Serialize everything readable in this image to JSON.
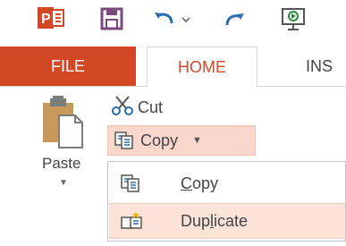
{
  "quick_access": {
    "logo_icon": "powerpoint-logo-icon",
    "logo_text": "P",
    "save_icon": "save-icon",
    "undo_icon": "undo-icon",
    "redo_icon": "redo-icon",
    "present_icon": "start-slideshow-icon"
  },
  "tabs": {
    "file": "FILE",
    "home": "HOME",
    "insert": "INS"
  },
  "clipboard": {
    "paste_label": "Paste",
    "cut_label": "Cut",
    "copy_label": "Copy"
  },
  "copy_menu": {
    "items": [
      {
        "prefix": "",
        "underlined": "C",
        "suffix": "opy",
        "icon": "copy-icon"
      },
      {
        "prefix": "Dup",
        "underlined": "l",
        "suffix": "icate",
        "icon": "duplicate-icon"
      }
    ]
  },
  "colors": {
    "accent": "#d24726",
    "highlight": "#f9d7cc"
  }
}
